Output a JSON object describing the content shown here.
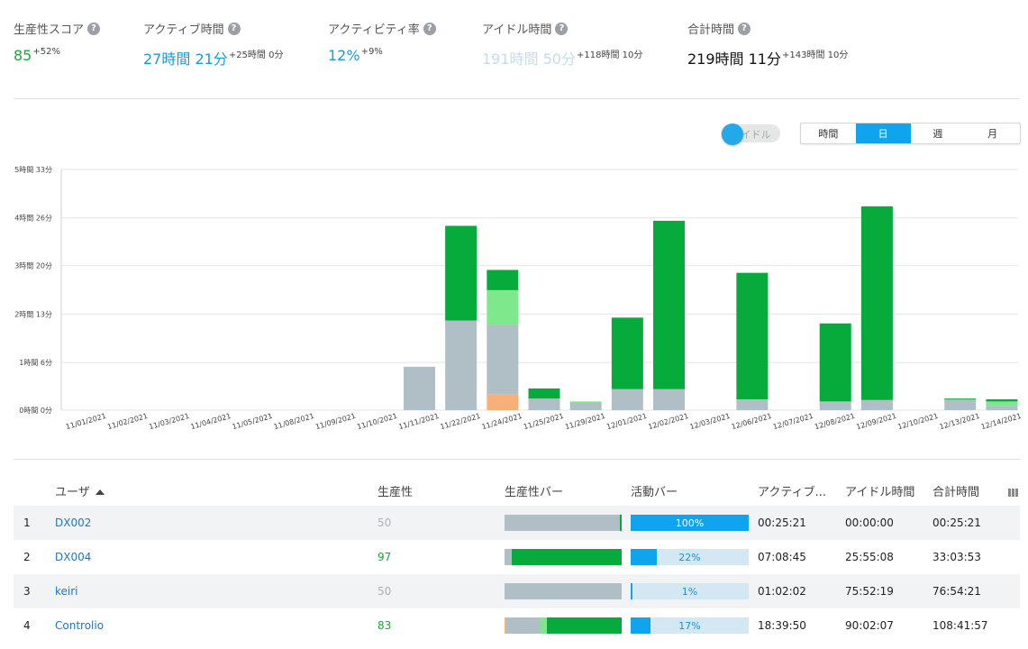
{
  "stats": [
    {
      "label": "生産性スコア",
      "value": "85",
      "delta": "+52%",
      "color": "#1ea43a"
    },
    {
      "label": "アクティブ時間",
      "value": "27時間 21分",
      "delta": "+25時間 0分",
      "color": "#1a9ad6"
    },
    {
      "label": "アクティビティ率",
      "value": "12%",
      "delta": "+9%",
      "color": "#1a9ad6"
    },
    {
      "label": "アイドル時間",
      "value": "191時間 50分",
      "delta": "+118時間 10分",
      "color": "#c4dced"
    },
    {
      "label": "合計時間",
      "value": "219時間 11分",
      "delta": "+143時間 10分",
      "color": "#111111"
    }
  ],
  "help_glyph": "?",
  "idle_toggle": {
    "label": "アイドル",
    "on": true
  },
  "period_tabs": [
    {
      "label": "時間",
      "active": false
    },
    {
      "label": "日",
      "active": true
    },
    {
      "label": "週",
      "active": false
    },
    {
      "label": "月",
      "active": false
    }
  ],
  "chart_data": {
    "type": "bar",
    "stacked": true,
    "categories": [
      "11/01/2021",
      "11/02/2021",
      "11/03/2021",
      "11/04/2021",
      "11/05/2021",
      "11/08/2021",
      "11/09/2021",
      "11/10/2021",
      "11/11/2021",
      "11/22/2021",
      "11/24/2021",
      "11/25/2021",
      "11/29/2021",
      "12/01/2021",
      "12/02/2021",
      "12/03/2021",
      "12/06/2021",
      "12/07/2021",
      "12/08/2021",
      "12/09/2021",
      "12/10/2021",
      "12/13/2021",
      "12/14/2021"
    ],
    "series": [
      {
        "name": "",
        "color": "#f8b07a",
        "values": [
          0,
          0,
          0,
          0,
          0,
          0,
          0,
          0,
          0,
          0,
          22,
          0,
          0,
          0,
          0,
          0,
          0,
          0,
          0,
          0,
          0,
          0,
          0
        ]
      },
      {
        "name": "",
        "color": "#b0bec5",
        "values": [
          0,
          0,
          0,
          0,
          0,
          0,
          0,
          0,
          60,
          124,
          96,
          16,
          10,
          29,
          29,
          0,
          15,
          0,
          12,
          14,
          0,
          15,
          6
        ]
      },
      {
        "name": "",
        "color": "#7de88c",
        "values": [
          0,
          0,
          0,
          0,
          0,
          0,
          0,
          0,
          0,
          0,
          48,
          0,
          2,
          0,
          0,
          0,
          0,
          0,
          0,
          0,
          0,
          0,
          6
        ]
      },
      {
        "name": "",
        "color": "#07ab3c",
        "values": [
          0,
          0,
          0,
          0,
          0,
          0,
          0,
          0,
          0,
          131,
          28,
          14,
          0,
          99,
          233,
          0,
          175,
          0,
          108,
          268,
          0,
          1,
          3
        ]
      }
    ],
    "y_ticks": [
      "0時間 0分",
      "1時間 6分",
      "2時間 13分",
      "3時間 20分",
      "4時間 26分",
      "5時間 33分"
    ],
    "y_tick_minutes": [
      0,
      66,
      133,
      200,
      266,
      333
    ],
    "ylim": [
      0,
      333
    ],
    "grid": true
  },
  "table": {
    "headers": {
      "user": "ユーザ",
      "productivity": "生産性",
      "prod_bar": "生産性バー",
      "activity_bar": "活動バー",
      "active": "アクティブ...",
      "idle": "アイドル時間",
      "total": "合計時間"
    },
    "rows": [
      {
        "num": "1",
        "user": "DX002",
        "productivity": "50",
        "prod_color": "#a9b2b8",
        "prod_bar": {
          "orange": 0,
          "gray": 0.985,
          "light": 0,
          "green": 0.015
        },
        "activity_pct": 1.0,
        "activity_label": "100%",
        "active": "00:25:21",
        "idle": "00:00:00",
        "total": "00:25:21"
      },
      {
        "num": "2",
        "user": "DX004",
        "productivity": "97",
        "prod_color": "#1ea43a",
        "prod_bar": {
          "orange": 0,
          "gray": 0.06,
          "light": 0,
          "green": 0.94
        },
        "activity_pct": 0.22,
        "activity_label": "22%",
        "active": "07:08:45",
        "idle": "25:55:08",
        "total": "33:03:53"
      },
      {
        "num": "3",
        "user": "keiri",
        "productivity": "50",
        "prod_color": "#a9b2b8",
        "prod_bar": {
          "orange": 0,
          "gray": 1.0,
          "light": 0,
          "green": 0
        },
        "activity_pct": 0.015,
        "activity_label": "1%",
        "active": "01:02:02",
        "idle": "75:52:19",
        "total": "76:54:21"
      },
      {
        "num": "4",
        "user": "Controlio",
        "productivity": "83",
        "prod_color": "#1ea43a",
        "prod_bar": {
          "orange": 0.015,
          "gray": 0.29,
          "light": 0.06,
          "green": 0.635
        },
        "activity_pct": 0.17,
        "activity_label": "17%",
        "active": "18:39:50",
        "idle": "90:02:07",
        "total": "108:41:57"
      }
    ]
  }
}
